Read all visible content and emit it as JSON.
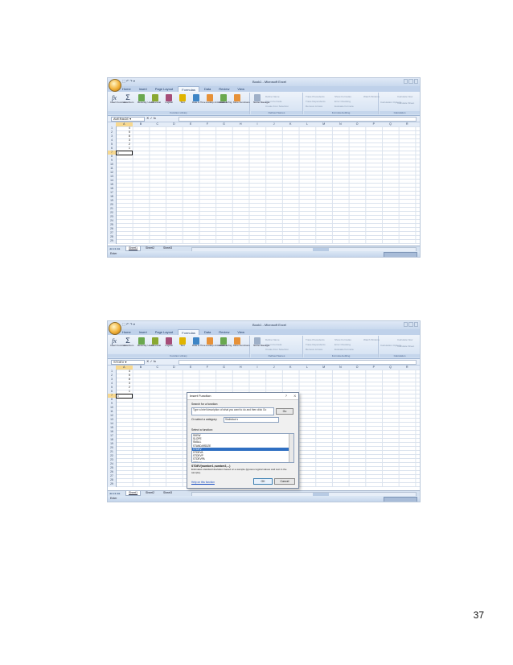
{
  "page_number": "37",
  "excel": {
    "window_title": "Book1 - Microsoft Excel",
    "qat": "⬚ ↶ ↷ ▾",
    "tabs": [
      "Home",
      "Insert",
      "Page Layout",
      "Formulas",
      "Data",
      "Review",
      "View"
    ],
    "active_tab": "Formulas",
    "ribbon": {
      "buttons": [
        {
          "label": "Insert Function",
          "icon": "fx-icon",
          "color": "#5a6f95"
        },
        {
          "label": "AutoSum",
          "icon": "sigma-icon",
          "color": "#4a5e86"
        },
        {
          "label": "Recently Used",
          "icon": "star-book-icon",
          "color": "#6aa84f"
        },
        {
          "label": "Financial",
          "icon": "book-icon",
          "color": "#8aa832"
        },
        {
          "label": "Logical",
          "icon": "book-icon",
          "color": "#a64d79"
        },
        {
          "label": "Text",
          "icon": "book-icon",
          "color": "#e0b400"
        },
        {
          "label": "Date & Time",
          "icon": "clock-icon",
          "color": "#3d85c6"
        },
        {
          "label": "Lookup & Reference",
          "icon": "book-icon",
          "color": "#e69138"
        },
        {
          "label": "Math & Trig",
          "icon": "book-icon",
          "color": "#6aa84f"
        },
        {
          "label": "More Functions",
          "icon": "book-icon",
          "color": "#e69138"
        },
        {
          "label": "Name Manager",
          "icon": "tag-icon",
          "color": "#9fb0c8"
        }
      ],
      "group_labels": [
        "Function Library",
        "Defined Names",
        "Formula Auditing",
        "Calculation"
      ],
      "small_items": [
        "Define Name",
        "Use in Formula",
        "Create from Selection",
        "Trace Precedents",
        "Trace Dependents",
        "Remove Arrows",
        "Show Formulas",
        "Error Checking",
        "Evaluate Formula",
        "Watch Window",
        "Calculation Options",
        "Calculate Now",
        "Calculate Sheet"
      ]
    },
    "columns": [
      "A",
      "B",
      "C",
      "D",
      "E",
      "F",
      "G",
      "H",
      "I",
      "J",
      "K",
      "L",
      "M",
      "N",
      "O",
      "P",
      "Q",
      "R",
      "S"
    ],
    "rows": [
      "1",
      "2",
      "3",
      "4",
      "5",
      "6",
      "7",
      "8",
      "9",
      "10",
      "11",
      "12",
      "13",
      "14",
      "15",
      "16",
      "17",
      "18",
      "19",
      "20",
      "21",
      "22",
      "23",
      "24",
      "25",
      "26",
      "27",
      "28",
      "29"
    ],
    "cell_values": [
      "4",
      "5",
      "8",
      "3",
      "2",
      "1"
    ],
    "fx_label": "✕ ✓ fx",
    "sheet_tabs": [
      "Sheet1",
      "Sheet2",
      "Sheet3"
    ],
    "sheet_nav": "◂◂ ◂ ▸ ▸▸",
    "status": "Enter"
  },
  "shot1": {
    "namebox": "AVERAGE",
    "formula": "="
  },
  "shot2": {
    "namebox": "STDEV",
    "formula": "=",
    "dialog": {
      "title": "Insert Function",
      "help_glyph": "?",
      "close_glyph": "X",
      "search_label": "Search for a function:",
      "search_text": "Type a brief description of what you want to do and then click Go",
      "go_button": "Go",
      "category_label": "Or select a category:",
      "category_value": "Statistical",
      "select_label": "Select a function:",
      "functions": [
        "SKEW",
        "SLOPE",
        "SMALL",
        "STANDARDIZE",
        "STDEV",
        "STDEVA",
        "STDEVP",
        "STDEVPA",
        "STEYX"
      ],
      "selected_function": "STDEV",
      "signature": "STDEV(number1,number2,...)",
      "description": "Estimates standard deviation based on a sample (ignores logical values and text in the sample).",
      "help_link": "Help on this function",
      "ok_button": "OK",
      "cancel_button": "Cancel"
    }
  }
}
